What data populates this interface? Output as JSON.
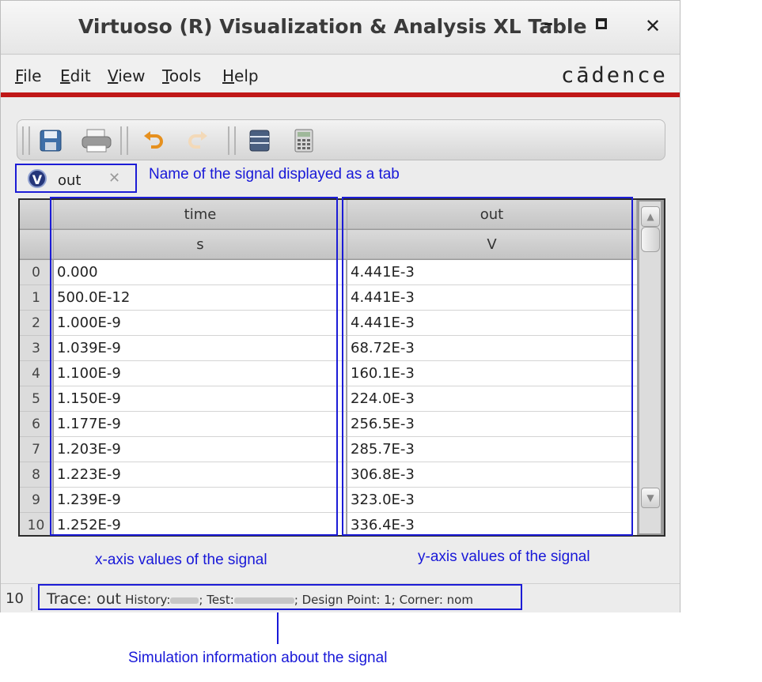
{
  "window": {
    "title": "Virtuoso (R) Visualization & Analysis XL Table",
    "minimize_glyph": "–",
    "close_glyph": "✕"
  },
  "menu": {
    "items": [
      {
        "mnemonic": "F",
        "rest": "ile"
      },
      {
        "mnemonic": "E",
        "rest": "dit"
      },
      {
        "mnemonic": "V",
        "rest": "iew"
      },
      {
        "mnemonic": "T",
        "rest": "ools"
      },
      {
        "mnemonic": "H",
        "rest": "elp"
      }
    ],
    "brand": "cādence"
  },
  "toolbar": {
    "icons": [
      "save-icon",
      "print-icon",
      "undo-icon",
      "redo-icon",
      "table-layout-icon",
      "calculator-icon"
    ]
  },
  "tab": {
    "icon_letter": "V",
    "label": "out",
    "close_glyph": "✕"
  },
  "annotations": {
    "tab_note": "Name of the signal displayed as a tab",
    "x_note": "x-axis values of the signal",
    "y_note": "y-axis values of the signal",
    "sim_note": "Simulation information about the signal"
  },
  "table": {
    "columns": [
      {
        "name": "time",
        "unit": "s"
      },
      {
        "name": "out",
        "unit": "V"
      }
    ],
    "rows": [
      {
        "index": "0",
        "x": "0.000",
        "y": "4.441E-3"
      },
      {
        "index": "1",
        "x": "500.0E-12",
        "y": "4.441E-3"
      },
      {
        "index": "2",
        "x": "1.000E-9",
        "y": "4.441E-3"
      },
      {
        "index": "3",
        "x": "1.039E-9",
        "y": "68.72E-3"
      },
      {
        "index": "4",
        "x": "1.100E-9",
        "y": "160.1E-3"
      },
      {
        "index": "5",
        "x": "1.150E-9",
        "y": "224.0E-3"
      },
      {
        "index": "6",
        "x": "1.177E-9",
        "y": "256.5E-3"
      },
      {
        "index": "7",
        "x": "1.203E-9",
        "y": "285.7E-3"
      },
      {
        "index": "8",
        "x": "1.223E-9",
        "y": "306.8E-3"
      },
      {
        "index": "9",
        "x": "1.239E-9",
        "y": "323.0E-3"
      },
      {
        "index": "10",
        "x": "1.252E-9",
        "y": "336.4E-3"
      }
    ]
  },
  "status": {
    "count": "10",
    "trace": "Trace: out",
    "history_label": "History:",
    "test_label": "; Test:",
    "design_point": "; Design Point: 1; Corner: nom"
  },
  "colors": {
    "annotation_blue": "#1818d8",
    "brand_red": "#c01818"
  }
}
